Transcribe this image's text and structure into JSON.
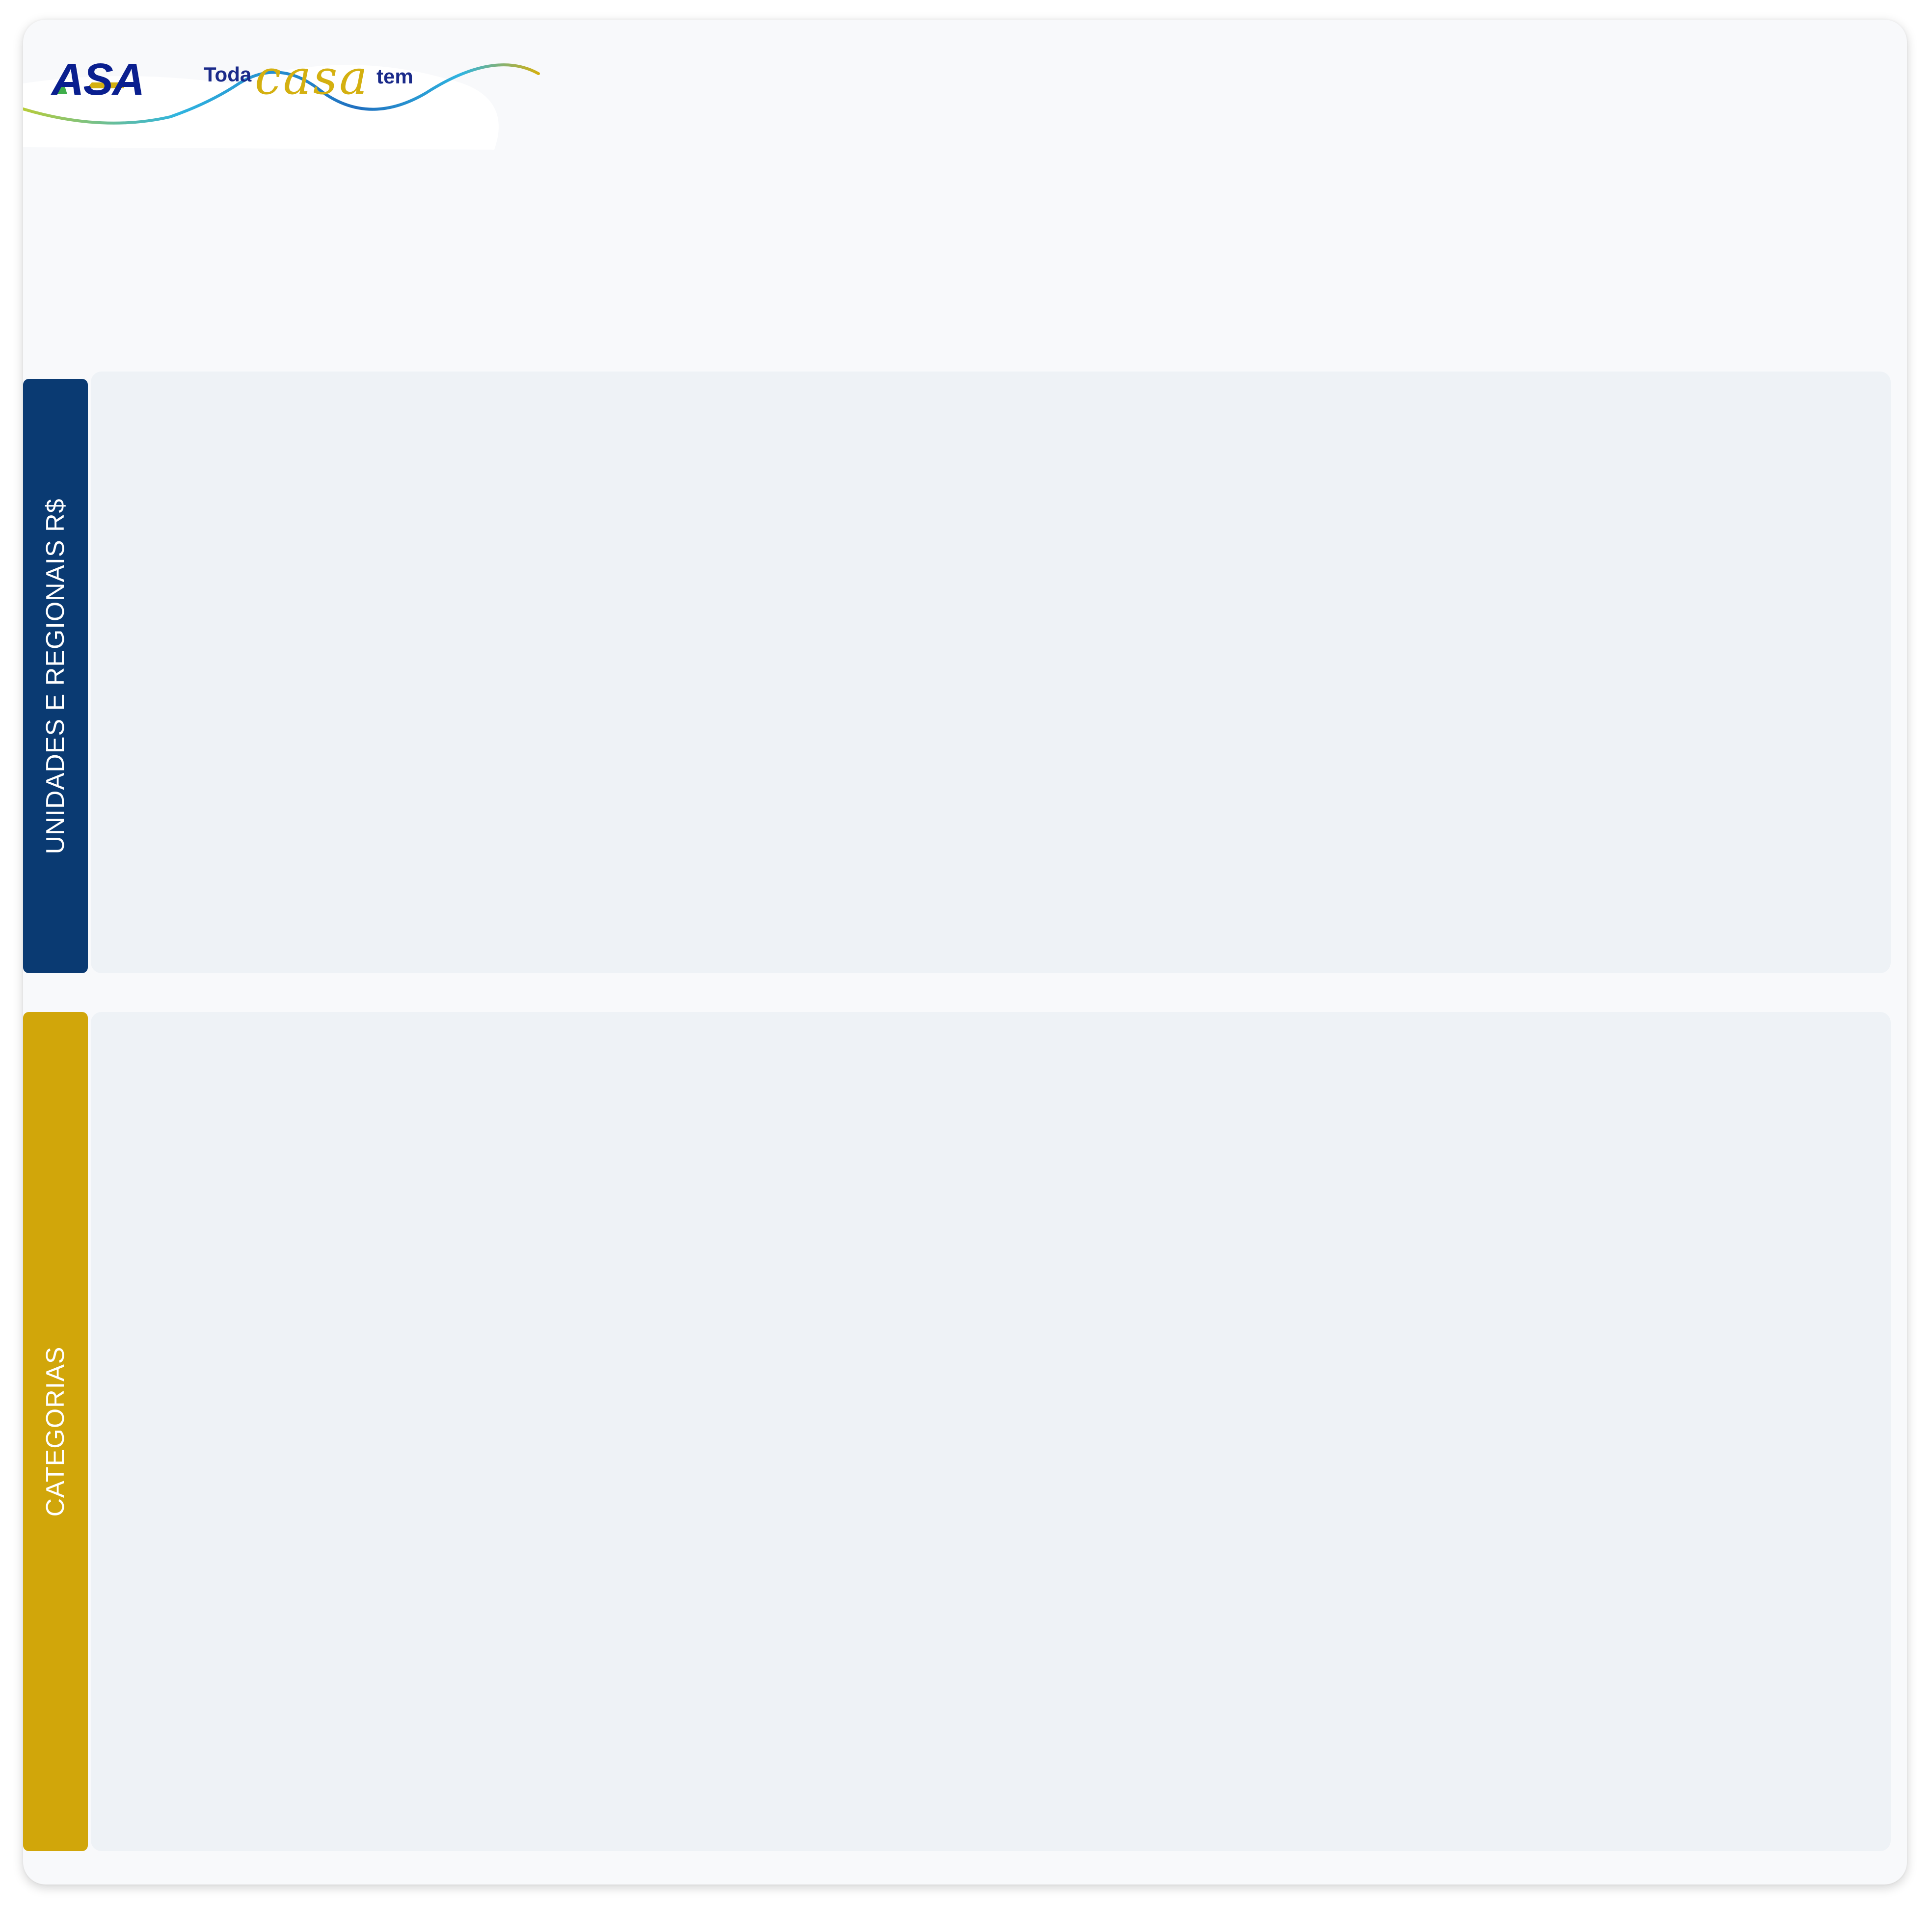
{
  "header": {
    "brand": "ASA",
    "tagline_prefix": "Toda",
    "tagline_script": "casa",
    "tagline_suffix": "tem"
  },
  "sections": [
    {
      "title": "UNIDADES E REGIONAIS R$",
      "accent_color": "#0a3a72"
    },
    {
      "title": "CATEGORIAS",
      "accent_color": "#d1a60a"
    }
  ],
  "colors": {
    "page_background": "#f8f9fb",
    "panel_background": "#eef2f6",
    "brand_blue": "#0a1f8f"
  }
}
